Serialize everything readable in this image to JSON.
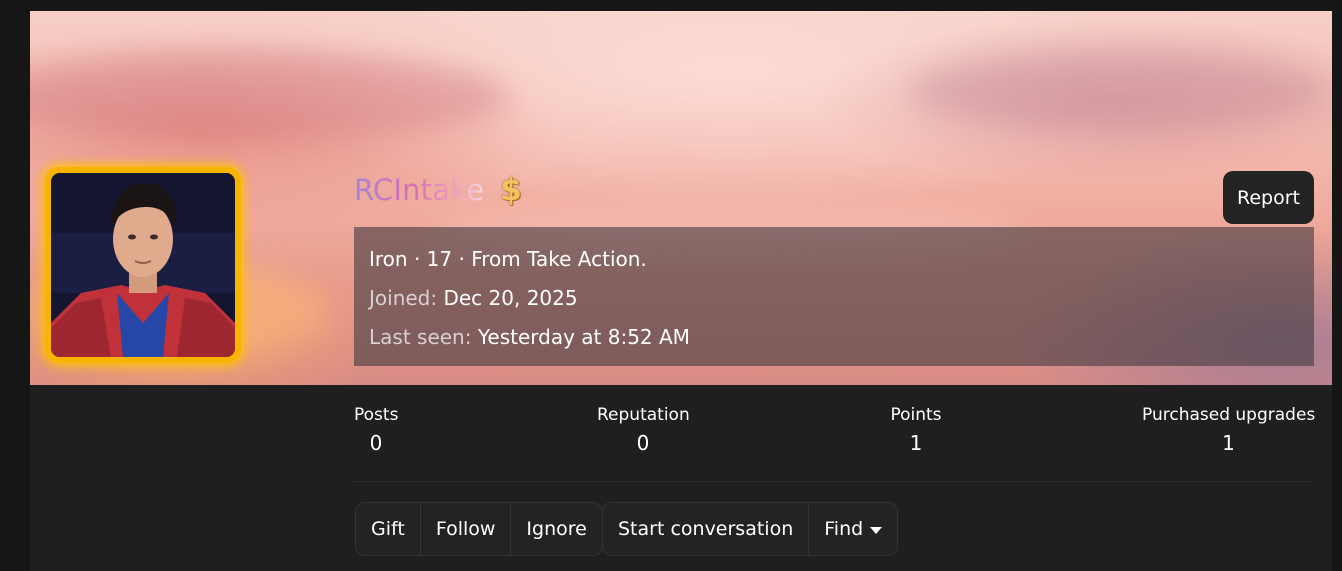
{
  "profile": {
    "username": "RCIntake",
    "badge_icon": "dollar-icon",
    "badge_glyph": "$",
    "report_label": "Report",
    "info_line": "Iron · 17 · From Take Action.",
    "joined_label": "Joined:",
    "joined_value": "Dec 20, 2025",
    "last_seen_label": "Last seen:",
    "last_seen_value": "Yesterday at 8:52 AM"
  },
  "stats": [
    {
      "label": "Posts",
      "value": "0"
    },
    {
      "label": "Reputation",
      "value": "0"
    },
    {
      "label": "Points",
      "value": "1"
    },
    {
      "label": "Purchased upgrades",
      "value": "1"
    }
  ],
  "actions": {
    "gift_label": "Gift",
    "follow_label": "Follow",
    "ignore_label": "Ignore",
    "start_conversation_label": "Start conversation",
    "find_label": "Find"
  },
  "colors": {
    "page_background": "#1f1f1f",
    "avatar_border": "#f8b400",
    "username_gradient_start": "#a486d8",
    "username_gradient_end": "#f0a2c2"
  }
}
